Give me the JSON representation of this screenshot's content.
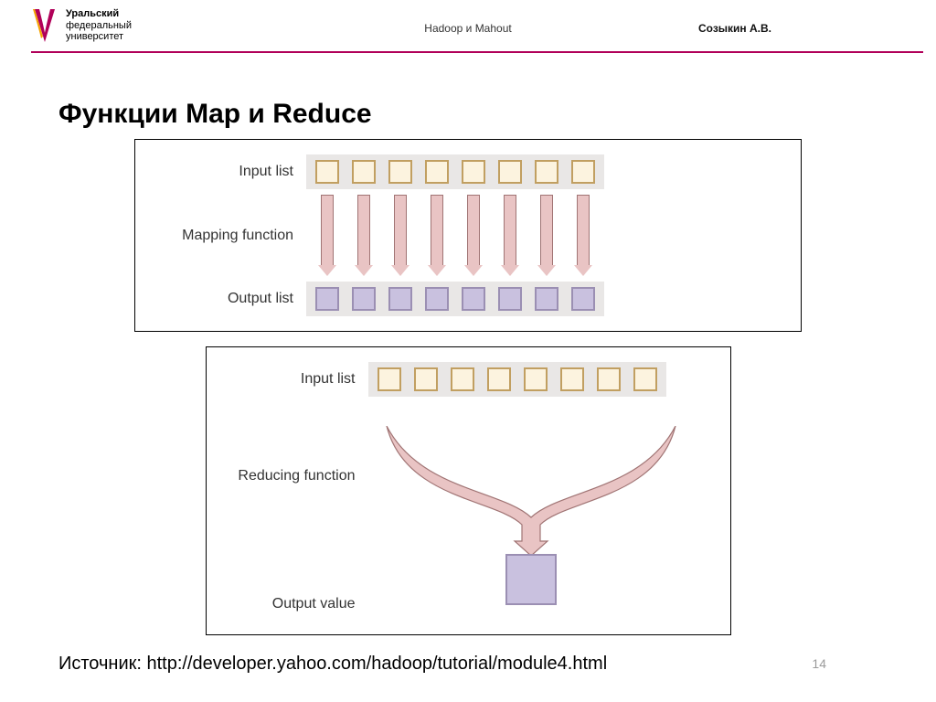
{
  "header": {
    "logo_line1": "Уральский",
    "logo_line2": "федеральный",
    "logo_line3": "университет",
    "center": "Hadoop и Mahout",
    "right": "Созыкин А.В."
  },
  "title": "Функции Map и Reduce",
  "map": {
    "input_label": "Input list",
    "function_label": "Mapping function",
    "output_label": "Output list",
    "count": 8
  },
  "reduce": {
    "input_label": "Input list",
    "function_label": "Reducing function",
    "output_label": "Output value",
    "count": 8
  },
  "source": "Источник: http://developer.yahoo.com/hadoop/tutorial/module4.html",
  "page_number": "14",
  "colors": {
    "accent_rule": "#b10059",
    "input_cell_fill": "#fcf3df",
    "input_cell_border": "#c19f61",
    "output_cell_fill": "#c9c1df",
    "output_cell_border": "#9b8fb3",
    "arrow_fill": "#e9c4c4",
    "arrow_stroke": "#a07474",
    "strip_bg": "#e9e7e6"
  }
}
